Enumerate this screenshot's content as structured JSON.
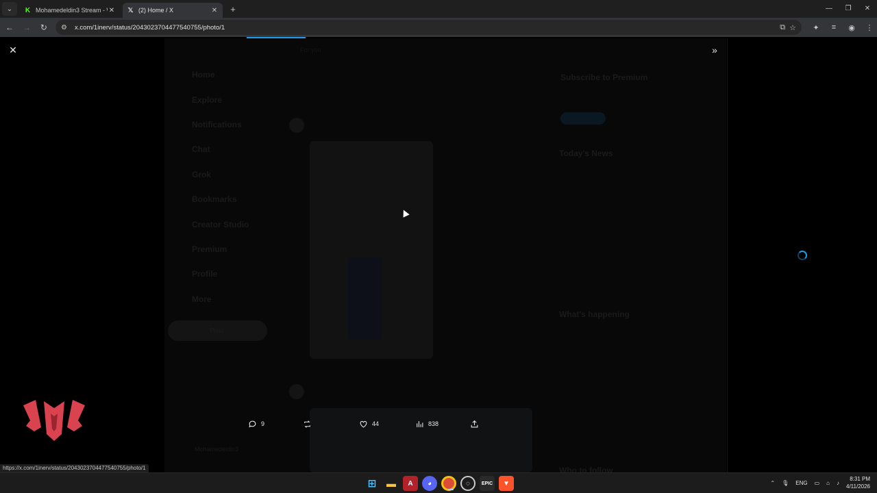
{
  "browser": {
    "tabs": [
      {
        "title": "Mohamedeldin3 Stream - Watc",
        "favicon": "kick-icon",
        "color": "#53fc18",
        "active": false
      },
      {
        "title": "(2) Home / X",
        "favicon": "x-icon",
        "color": "#ffffff",
        "active": true
      }
    ],
    "url": "x.com/1inerv/status/2043023704477540755/photo/1",
    "status_url": "https://x.com/1inerv/status/2043023704477540755/photo/1"
  },
  "photo_viewer": {
    "close_label": "✕",
    "expand_label": "»",
    "actions": {
      "replies": "9",
      "reposts": "",
      "likes": "44",
      "views": "838"
    }
  },
  "background_ghost": {
    "nav": [
      "Home",
      "Explore",
      "Notifications",
      "Chat",
      "Grok",
      "Bookmarks",
      "Creator Studio",
      "Premium",
      "Profile",
      "More"
    ],
    "post_button": "Post",
    "top_tabs": [
      "For you"
    ],
    "premium_title": "Subscribe to Premium",
    "news_title": "Today's News",
    "happening_title": "What's happening",
    "follow_title": "Who to follow",
    "account_name": "Mohamedeldin3"
  },
  "taskbar": {
    "language": "ENG",
    "time": "8:31 PM",
    "date": "4/11/2026"
  },
  "colors": {
    "accent": "#1d9bf0",
    "background": "#000000"
  }
}
